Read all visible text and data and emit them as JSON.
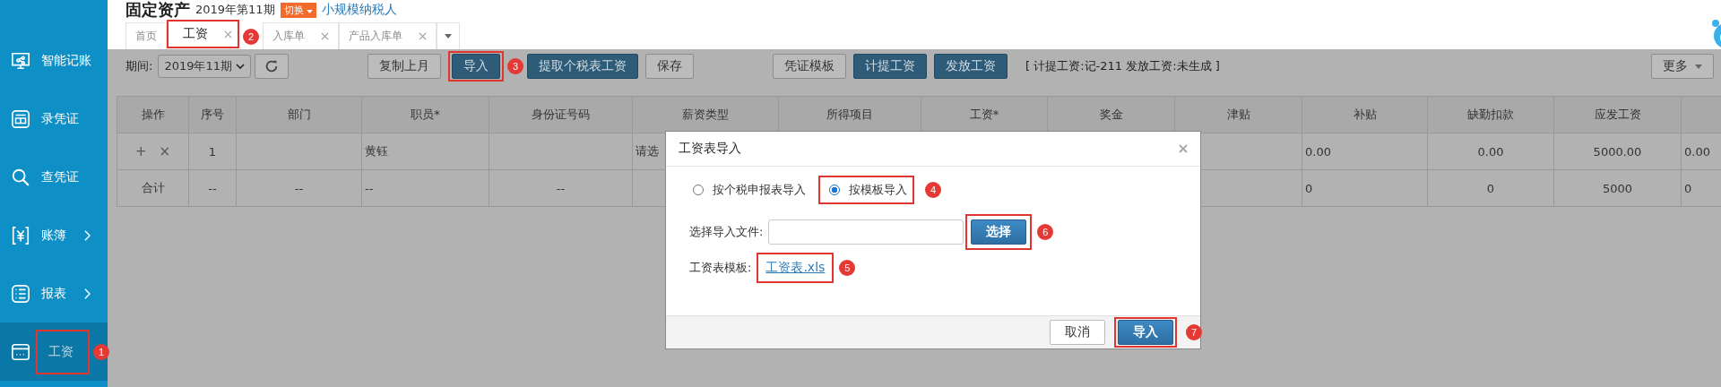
{
  "header": {
    "title": "固定资产",
    "period": "2019年第11期",
    "switch_badge": "切换",
    "taxpayer_link": "小规模纳税人"
  },
  "tabs": [
    {
      "label": "首页",
      "selected": false,
      "closable": false
    },
    {
      "label": "工资",
      "selected": true,
      "closable": true,
      "callout": "2"
    },
    {
      "label": "入库单",
      "selected": false,
      "closable": true
    },
    {
      "label": "产品入库单",
      "selected": false,
      "closable": true
    }
  ],
  "sidebar": {
    "items": [
      {
        "label": "智能记账",
        "selected": false,
        "has_submenu": false
      },
      {
        "label": "录凭证",
        "selected": false,
        "has_submenu": false
      },
      {
        "label": "查凭证",
        "selected": false,
        "has_submenu": false
      },
      {
        "label": "账簿",
        "selected": false,
        "has_submenu": true
      },
      {
        "label": "报表",
        "selected": false,
        "has_submenu": true
      },
      {
        "label": "工资",
        "selected": true,
        "has_submenu": false,
        "callout": "1"
      }
    ]
  },
  "toolbar": {
    "period_label": "期间:",
    "period_value": "2019年11期",
    "left_buttons": [
      {
        "label": "复制上月",
        "kind": "default"
      },
      {
        "label": "导入",
        "kind": "primary",
        "callout": "3"
      },
      {
        "label": "提取个税表工资",
        "kind": "primary"
      },
      {
        "label": "保存",
        "kind": "default"
      }
    ],
    "right_buttons": [
      {
        "label": "凭证模板",
        "kind": "default"
      },
      {
        "label": "计提工资",
        "kind": "primary"
      },
      {
        "label": "发放工资",
        "kind": "primary"
      }
    ],
    "status": "[ 计提工资:记-211 发放工资:未生成 ]",
    "more": "更多"
  },
  "table": {
    "columns": [
      "操作",
      "序号",
      "部门",
      "职员*",
      "身份证号码",
      "薪资类型",
      "所得项目",
      "工资*",
      "奖金",
      "津贴",
      "补贴",
      "缺勤扣款",
      "应发工资",
      null
    ],
    "rows": [
      {
        "kind": "entry",
        "actions": [
          "+",
          "×"
        ],
        "cells": [
          "",
          "1",
          "",
          "黄钰",
          "",
          "请选",
          "",
          "",
          "",
          "",
          "0.00",
          "0.00",
          "5000.00",
          "0.00"
        ]
      },
      {
        "kind": "total",
        "cells": [
          "合计",
          "--",
          "--",
          "--",
          "--",
          "",
          "",
          "",
          "",
          "",
          "0",
          "0",
          "5000",
          "0"
        ]
      }
    ]
  },
  "dialog": {
    "title": "工资表导入",
    "options": [
      {
        "label": "按个税申报表导入",
        "selected": false
      },
      {
        "label": "按模板导入",
        "selected": true,
        "callout": "4"
      }
    ],
    "file_label": "选择导入文件:",
    "choose_button": {
      "label": "选择",
      "callout": "6"
    },
    "template_label": "工资表模板:",
    "template_link": {
      "label": "工资表.xls",
      "callout": "5"
    },
    "buttons": [
      {
        "label": "取消",
        "kind": "default"
      },
      {
        "label": "导入",
        "kind": "primary",
        "callout": "7"
      }
    ]
  }
}
